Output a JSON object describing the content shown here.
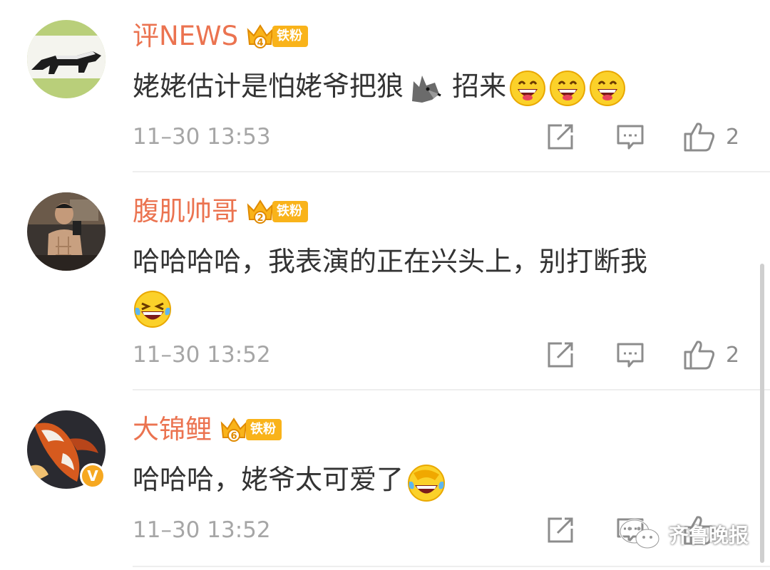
{
  "comments": [
    {
      "username": "评NEWS",
      "fan_level": "4",
      "fan_label": "铁粉",
      "text": "姥姥估计是怕姥爷把狼",
      "text_after_wolf": " 招来",
      "timestamp": "11–30 13:53",
      "like_count": "2"
    },
    {
      "username": "腹肌帅哥",
      "fan_level": "2",
      "fan_label": "铁粉",
      "text": "哈哈哈哈，我表演的正在兴头上，别打断我",
      "timestamp": "11–30 13:52",
      "like_count": "2"
    },
    {
      "username": "大锦鲤",
      "fan_level": "6",
      "fan_label": "铁粉",
      "text": "哈哈哈，姥爷太可爱了",
      "timestamp": "11–30 13:52",
      "like_count": "",
      "verified_mark": "V"
    }
  ],
  "watermark": "齐鲁晚报",
  "colors": {
    "username": "#eb7350",
    "fan_badge": "#f9b31a",
    "timestamp": "#a6a6a6",
    "body_text": "#333333"
  },
  "icons": [
    "repost-icon",
    "comment-icon",
    "like-icon",
    "crown-icon",
    "wolf-emoji",
    "grin-emoji",
    "laugh-cry-emoji",
    "wechat-icon"
  ]
}
